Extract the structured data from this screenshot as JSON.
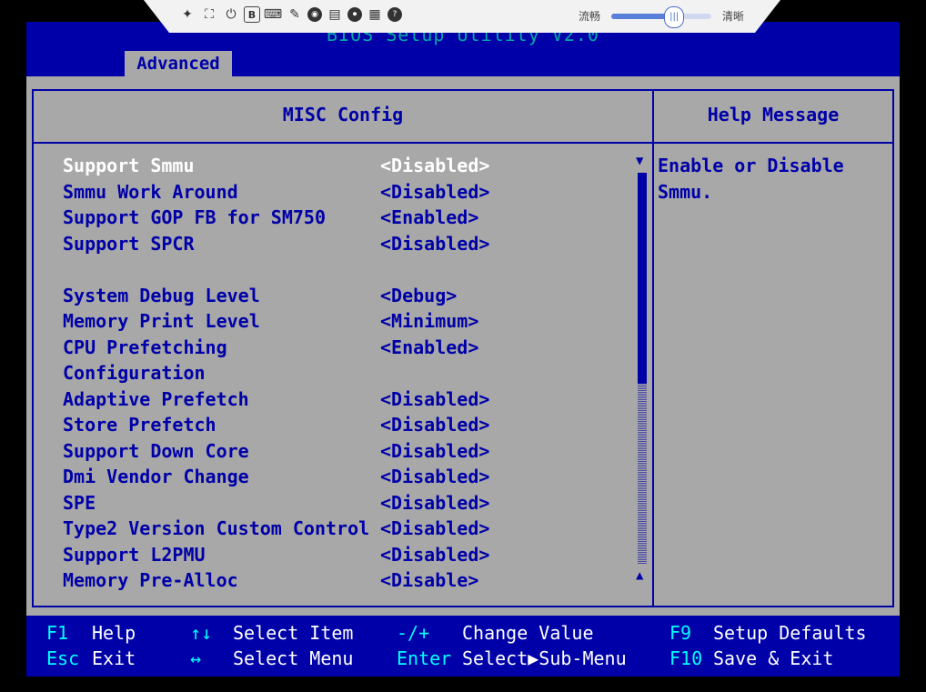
{
  "kvm_toolbar": {
    "icons": [
      "pin-icon",
      "fullscreen-icon",
      "power-icon",
      "b-icon",
      "keyboard-icon",
      "mouse-icon",
      "disc-icon",
      "media-icon",
      "record-icon",
      "virtual-keyboard-icon",
      "help-icon"
    ],
    "icon_glyphs": [
      "✦",
      "⛶",
      "⏻",
      "B",
      "⌨",
      "✎",
      "◉",
      "▤",
      "⏺",
      "▦",
      "?"
    ],
    "quality_left": "流畅",
    "quality_right": "清晰",
    "quality_level": 0.62
  },
  "title": "BIOS Setup Utility V2.0",
  "active_tab": "Advanced",
  "panel_title": "MISC Config",
  "help_title": "Help Message",
  "help_text": "Enable or Disable Smmu.",
  "settings": [
    {
      "label": "Support Smmu",
      "value": "<Disabled>",
      "selected": true
    },
    {
      "label": "Smmu Work Around",
      "value": "<Disabled>"
    },
    {
      "label": "Support GOP FB for SM750",
      "value": "<Enabled>"
    },
    {
      "label": "Support SPCR",
      "value": "<Disabled>"
    },
    {
      "spacer": true
    },
    {
      "label": "System Debug Level",
      "value": "<Debug>"
    },
    {
      "label": "Memory Print Level",
      "value": "<Minimum>"
    },
    {
      "label": "CPU Prefetching",
      "value": "<Enabled>"
    },
    {
      "label": "Configuration",
      "value": ""
    },
    {
      "label": "Adaptive Prefetch",
      "value": "<Disabled>"
    },
    {
      "label": "Store Prefetch",
      "value": "<Disabled>"
    },
    {
      "label": "Support Down Core",
      "value": "<Disabled>"
    },
    {
      "label": "Dmi Vendor Change",
      "value": "<Disabled>"
    },
    {
      "label": "SPE",
      "value": "<Disabled>"
    },
    {
      "label": "Type2 Version Custom Control",
      "value": "<Disabled>"
    },
    {
      "label": "Support L2PMU",
      "value": "<Disabled>"
    },
    {
      "label": "Memory Pre-Alloc",
      "value": "<Disable>"
    }
  ],
  "scroll": {
    "up_glyph": "▼",
    "down_glyph": "▲"
  },
  "keys": [
    {
      "key": "F1",
      "desc": "Help"
    },
    {
      "key": "Esc",
      "desc": "Exit"
    },
    {
      "key": "↑↓",
      "desc": "Select Item"
    },
    {
      "key": "↔",
      "desc": "Select Menu"
    },
    {
      "key": "-/+",
      "desc": "Change Value"
    },
    {
      "key": "Enter",
      "desc": "Select▶Sub-Menu"
    },
    {
      "key": "F9",
      "desc": "Setup Defaults"
    },
    {
      "key": "F10",
      "desc": "Save & Exit"
    }
  ],
  "colors": {
    "bios_blue": "#0000a8",
    "bios_gray": "#a8a8a8",
    "key_cyan": "#00ffff",
    "selected_text": "#ffffff"
  }
}
